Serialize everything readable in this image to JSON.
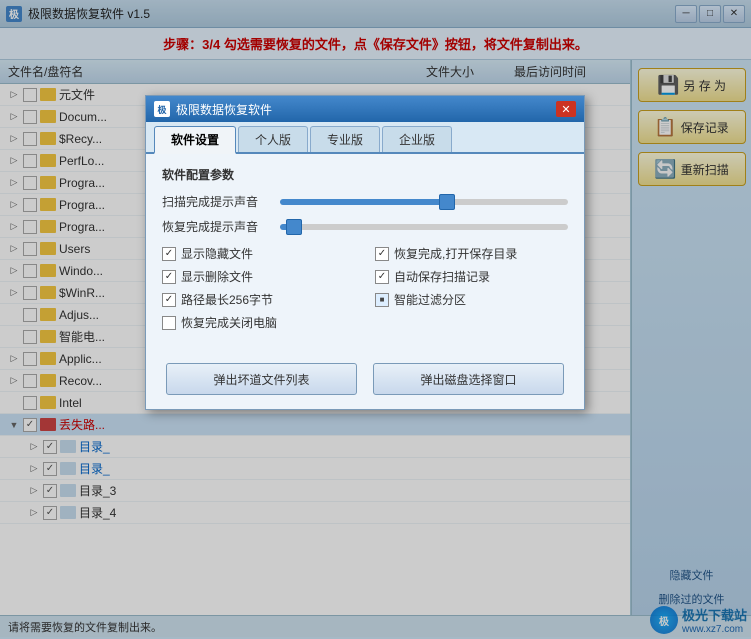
{
  "app": {
    "title": "极限数据恢复软件 v1.5",
    "icon_label": "极"
  },
  "title_controls": {
    "minimize": "─",
    "maximize": "□",
    "close": "✕"
  },
  "step_bar": {
    "text": "步骤：3/4 勾选需要恢复的文件，点《保存文件》按钮，将文件复制出来。"
  },
  "columns": {
    "name": "文件名/盘符名",
    "size": "文件大小",
    "date": "最后访问时间"
  },
  "tree_items": [
    {
      "indent": 0,
      "arrow": "▷",
      "checked": false,
      "icon": "yellow",
      "name": "元文件",
      "red": false
    },
    {
      "indent": 0,
      "arrow": "▷",
      "checked": false,
      "icon": "yellow",
      "name": "Docum...",
      "red": false
    },
    {
      "indent": 0,
      "arrow": "▷",
      "checked": false,
      "icon": "yellow",
      "name": "$Recy...",
      "red": false
    },
    {
      "indent": 0,
      "arrow": "▷",
      "checked": false,
      "icon": "yellow",
      "name": "PerfLo...",
      "red": false
    },
    {
      "indent": 0,
      "arrow": "▷",
      "checked": false,
      "icon": "yellow",
      "name": "Progra...",
      "red": false
    },
    {
      "indent": 0,
      "arrow": "▷",
      "checked": false,
      "icon": "yellow",
      "name": "Progra...",
      "red": false
    },
    {
      "indent": 0,
      "arrow": "▷",
      "checked": false,
      "icon": "yellow",
      "name": "Progra...",
      "red": false
    },
    {
      "indent": 0,
      "arrow": "▷",
      "checked": false,
      "icon": "yellow",
      "name": "Users",
      "red": false
    },
    {
      "indent": 0,
      "arrow": "▷",
      "checked": false,
      "icon": "yellow",
      "name": "Windo...",
      "red": false
    },
    {
      "indent": 0,
      "arrow": "▷",
      "checked": false,
      "icon": "yellow",
      "name": "$WinR...",
      "red": false
    },
    {
      "indent": 0,
      "arrow": "",
      "checked": false,
      "icon": "yellow",
      "name": "Adjus...",
      "red": false
    },
    {
      "indent": 0,
      "arrow": "",
      "checked": false,
      "icon": "yellow",
      "name": "智能电...",
      "red": false
    },
    {
      "indent": 0,
      "arrow": "▷",
      "checked": false,
      "icon": "yellow",
      "name": "Applic...",
      "red": false
    },
    {
      "indent": 0,
      "arrow": "▷",
      "checked": false,
      "icon": "yellow",
      "name": "Recov...",
      "red": false
    },
    {
      "indent": 0,
      "arrow": "",
      "checked": false,
      "icon": "yellow",
      "name": "Intel",
      "red": false
    },
    {
      "indent": 0,
      "arrow": "▼",
      "checked": true,
      "icon": "red",
      "name": "丢失路...",
      "red": true
    },
    {
      "indent": 1,
      "arrow": "▷",
      "checked": true,
      "icon": "light",
      "name": "目录_",
      "red": true,
      "blue": true
    },
    {
      "indent": 1,
      "arrow": "▷",
      "checked": true,
      "icon": "light",
      "name": "目录_",
      "red": false,
      "blue": true
    },
    {
      "indent": 1,
      "arrow": "▷",
      "checked": true,
      "icon": "light",
      "name": "目录_3",
      "red": false,
      "blue": false
    },
    {
      "indent": 1,
      "arrow": "▷",
      "checked": true,
      "icon": "light",
      "name": "目录_4",
      "red": false,
      "blue": false
    }
  ],
  "right_panel": {
    "buttons": [
      {
        "id": "save-as",
        "label": "另 存 为",
        "icon": "💾"
      },
      {
        "id": "save-record",
        "label": "保存记录",
        "icon": "📋"
      },
      {
        "id": "rescan",
        "label": "重新扫描",
        "icon": "🔄"
      }
    ],
    "hidden_labels": [
      "隐藏文件",
      "删除过的文件"
    ]
  },
  "status_bar": {
    "text": "请将需要恢复的文件复制出来。"
  },
  "watermark": {
    "logo": "极",
    "text": "极光下载站",
    "url": "www.xz7.com"
  },
  "modal": {
    "title": "极限数据恢复软件",
    "icon": "极",
    "tabs": [
      {
        "id": "software-settings",
        "label": "软件设置",
        "active": true
      },
      {
        "id": "personal",
        "label": "个人版"
      },
      {
        "id": "professional",
        "label": "专业版"
      },
      {
        "id": "enterprise",
        "label": "企业版"
      }
    ],
    "section_title": "软件配置参数",
    "sliders": [
      {
        "id": "scan-sound",
        "label": "扫描完成提示声音",
        "value": 60,
        "thumb_pct": 58
      },
      {
        "id": "restore-sound",
        "label": "恢复完成提示声音",
        "value": 8,
        "thumb_pct": 5
      }
    ],
    "checkboxes": [
      {
        "id": "show-hidden",
        "label": "显示隐藏文件",
        "checked": true,
        "col": 0
      },
      {
        "id": "open-dir",
        "label": "恢复完成,打开保存目录",
        "checked": true,
        "col": 1
      },
      {
        "id": "show-deleted",
        "label": "显示删除文件",
        "checked": true,
        "col": 0
      },
      {
        "id": "auto-save",
        "label": "自动保存扫描记录",
        "checked": true,
        "col": 1
      },
      {
        "id": "path-256",
        "label": "路径最长256字节",
        "checked": true,
        "col": 0
      },
      {
        "id": "smart-filter",
        "label": "智能过滤分区",
        "checked_sq": true,
        "col": 1
      },
      {
        "id": "shutdown",
        "label": "恢复完成关闭电脑",
        "checked": false,
        "col": 0
      }
    ],
    "buttons": [
      {
        "id": "bad-files",
        "label": "弹出坏道文件列表"
      },
      {
        "id": "select-disk",
        "label": "弹出磁盘选择窗口"
      }
    ],
    "close_btn": "✕"
  }
}
